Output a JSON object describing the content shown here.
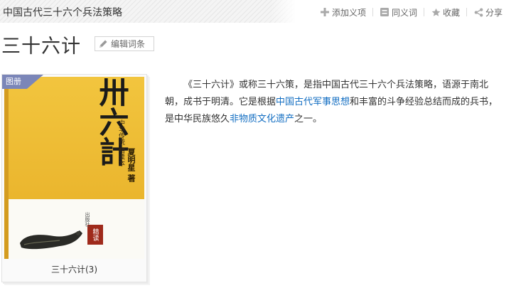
{
  "breadcrumb": {
    "title": "中国古代三十六个兵法策略"
  },
  "actions": [
    {
      "icon": "plus-icon",
      "label": "添加义项"
    },
    {
      "icon": "synonym-icon",
      "label": "同义词"
    },
    {
      "icon": "star-icon",
      "label": "收藏"
    },
    {
      "icon": "share-icon",
      "label": "分享"
    }
  ],
  "page": {
    "title": "三十六计",
    "edit_label": "编辑词条"
  },
  "album": {
    "badge": "图册",
    "caption": "三十六计(3)",
    "cover": {
      "calligraphy": "卅六計",
      "small_text": "中华传统·精读本",
      "author": "夏明星 著",
      "seal": "精读",
      "publisher": "出版社"
    }
  },
  "summary": {
    "part1": "《三十六计》或称三十六策，是指中国古代三十六个兵法策略，语源于南北朝，成书于明清。它是根据",
    "link1": "中国古代军事思想",
    "part2": "和丰富的斗争经验总结而成的兵书，是中华民族悠久",
    "link2": "非物质文化遗产",
    "part3": "之一。"
  },
  "colors": {
    "link": "#136ec2",
    "badge": "#7b86b8",
    "cover_yellow": "#f2c53e"
  }
}
